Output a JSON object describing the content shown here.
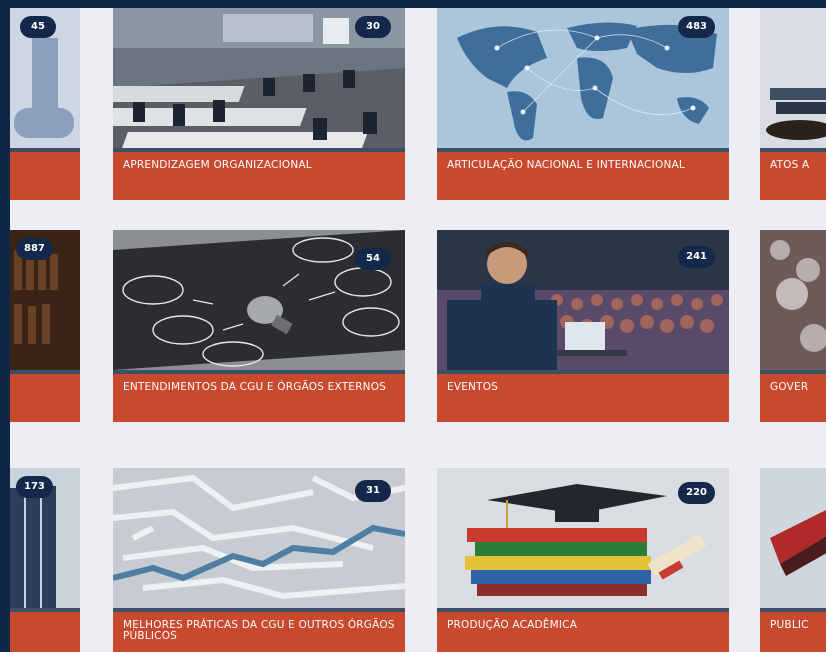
{
  "cards": [
    {
      "title": "",
      "count": "45"
    },
    {
      "title": "APRENDIZAGEM ORGANIZACIONAL",
      "count": "30"
    },
    {
      "title": "ARTICULAÇÃO NACIONAL E INTERNACIONAL",
      "count": "483"
    },
    {
      "title": "ATOS A",
      "count": ""
    },
    {
      "title": "",
      "count": "887"
    },
    {
      "title": "ENTENDIMENTOS DA CGU E ÓRGÃOS EXTERNOS",
      "count": "54"
    },
    {
      "title": "EVENTOS",
      "count": "241"
    },
    {
      "title": "GOVER",
      "count": ""
    },
    {
      "title": "",
      "count": "173"
    },
    {
      "title": "MELHORES PRÁTICAS DA CGU E OUTROS ÓRGÃOS PÚBLICOS",
      "count": "31"
    },
    {
      "title": "PRODUÇÃO ACADÊMICA",
      "count": "220"
    },
    {
      "title": "PUBLIC",
      "count": ""
    }
  ],
  "colors": {
    "caption_bg": "#c8492e",
    "badge_bg": "#13284a",
    "page_bg": "#eceef4",
    "frame_bg": "#0f2746"
  }
}
